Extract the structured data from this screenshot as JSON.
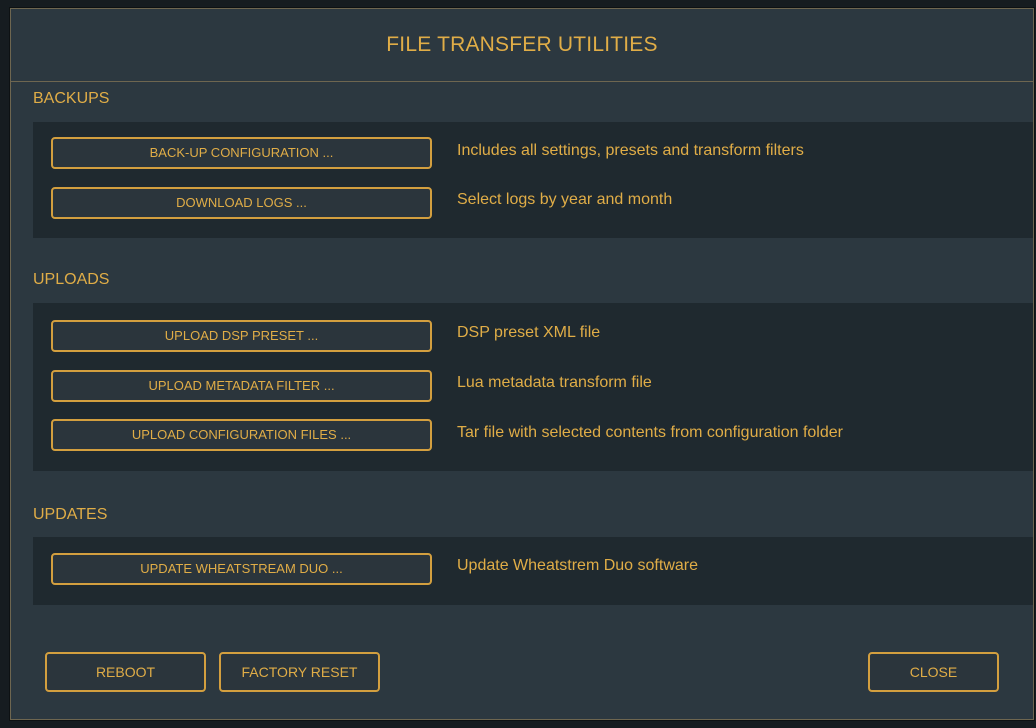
{
  "dialog": {
    "title": "FILE TRANSFER UTILITIES"
  },
  "backups": {
    "heading": "BACKUPS",
    "items": [
      {
        "button": "BACK-UP CONFIGURATION ...",
        "description": "Includes all settings, presets and transform filters"
      },
      {
        "button": "DOWNLOAD LOGS ...",
        "description": "Select logs by year and month"
      }
    ]
  },
  "uploads": {
    "heading": "UPLOADS",
    "items": [
      {
        "button": "UPLOAD DSP PRESET ...",
        "description": "DSP preset XML file"
      },
      {
        "button": "UPLOAD METADATA FILTER ...",
        "description": "Lua metadata transform file"
      },
      {
        "button": "UPLOAD CONFIGURATION FILES ...",
        "description": "Tar file with selected contents from configuration folder"
      }
    ]
  },
  "updates": {
    "heading": "UPDATES",
    "items": [
      {
        "button": "UPDATE WHEATSTREAM DUO ...",
        "description": "Update Wheatstrem Duo software"
      }
    ]
  },
  "footer": {
    "reboot": "REBOOT",
    "factory_reset": "FACTORY RESET",
    "close": "CLOSE"
  },
  "colors": {
    "accent": "#e0ad47",
    "dialog_background": "#2c3840",
    "panel_background": "#1f292f"
  }
}
